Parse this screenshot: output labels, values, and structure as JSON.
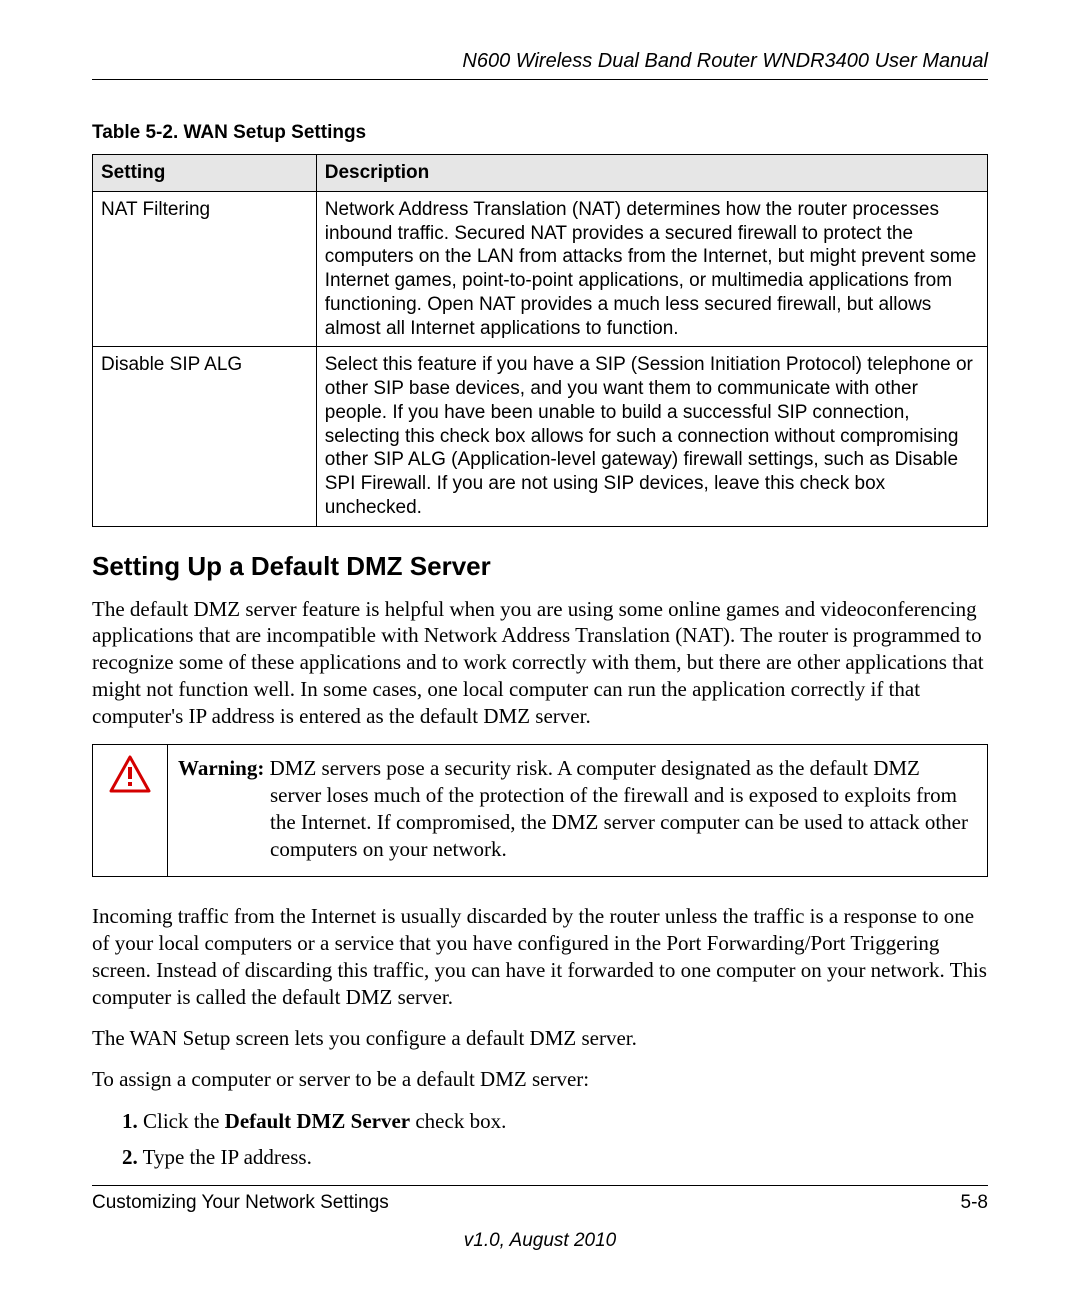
{
  "header": {
    "title": "N600 Wireless Dual Band Router WNDR3400 User Manual"
  },
  "table": {
    "caption": "Table 5-2.  WAN Setup Settings",
    "columns": [
      "Setting",
      "Description"
    ],
    "rows": [
      {
        "setting": "NAT Filtering",
        "description": "Network Address Translation (NAT) determines how the router processes inbound traffic. Secured NAT provides a secured firewall to protect the computers on the LAN from attacks from the Internet, but might prevent some Internet games, point-to-point applications, or multimedia applications from functioning. Open NAT provides a much less secured firewall, but allows almost all Internet applications to function."
      },
      {
        "setting": "Disable SIP ALG",
        "description": "Select this feature if you have a SIP (Session Initiation Protocol) telephone or other SIP base devices, and you want them to communicate with other people. If you have been unable to build a successful SIP connection, selecting this check box allows for such a connection without compromising other SIP ALG (Application-level gateway) firewall settings, such as Disable SPI Firewall. If you are not using SIP devices, leave this check box unchecked."
      }
    ]
  },
  "section": {
    "heading": "Setting Up a Default DMZ Server",
    "para1": "The default DMZ server feature is helpful when you are using some online games and videoconferencing applications that are incompatible with Network Address Translation (NAT). The router is programmed to recognize some of these applications and to work correctly with them, but there are other applications that might not function well. In some cases, one local computer can run the application correctly if that computer's IP address is entered as the default DMZ server.",
    "warning_label": "Warning:",
    "warning_first_line": " DMZ servers pose a security risk. A computer designated as the default DMZ",
    "warning_rest": "server loses much of the protection of the firewall and is exposed to exploits from the Internet. If compromised, the DMZ server computer can be used to attack other computers on your network.",
    "para2": "Incoming traffic from the Internet is usually discarded by the router unless the traffic is a response to one of your local computers or a service that you have configured in the Port Forwarding/Port Triggering screen. Instead of discarding this traffic, you can have it forwarded to one computer on your network. This computer is called the default DMZ server.",
    "para3": "The WAN Setup screen lets you configure a default DMZ server.",
    "para4": "To assign a computer or server to be a default DMZ server:",
    "steps": [
      {
        "num": "1.",
        "before": "Click the ",
        "bold": "Default DMZ Server",
        "after": " check box."
      },
      {
        "num": "2.",
        "before": "Type the IP address.",
        "bold": "",
        "after": ""
      }
    ]
  },
  "footer": {
    "left": "Customizing Your Network Settings",
    "right": "5-8",
    "version": "v1.0, August 2010"
  }
}
